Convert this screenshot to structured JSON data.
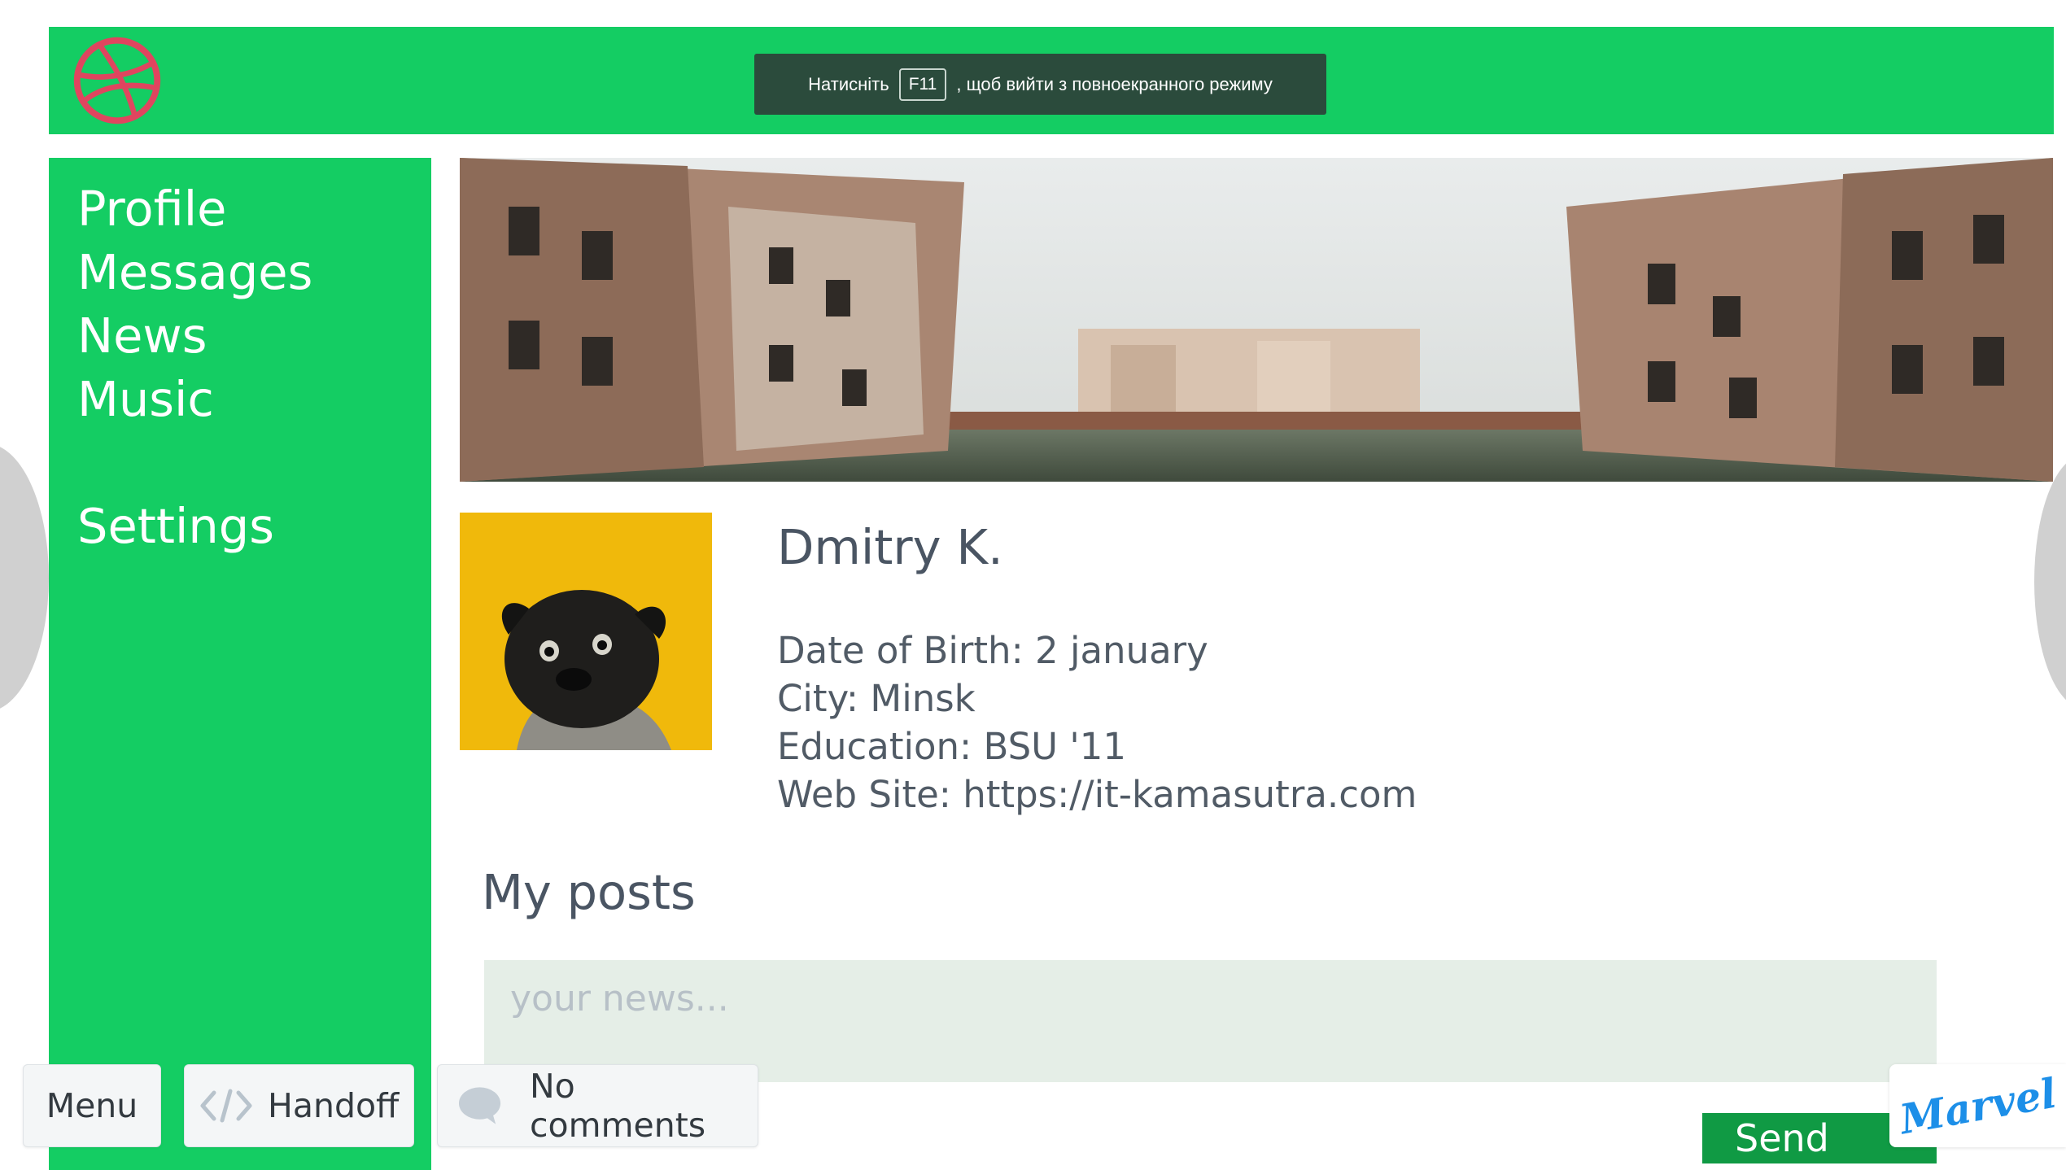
{
  "colors": {
    "brand_green": "#14cd63",
    "send_green": "#109a44",
    "text_dark": "#4a5563",
    "logo_pink": "#e0455f",
    "marvel_blue": "#1d8fe8"
  },
  "header": {
    "logo_icon": "dribbble-ball-icon",
    "fullscreen_notice": {
      "before": "Натисніть",
      "key": "F11",
      "after": ", щоб вийти з повноекранного режиму"
    }
  },
  "sidebar": {
    "items": [
      {
        "label": "Profile"
      },
      {
        "label": "Messages"
      },
      {
        "label": "News"
      },
      {
        "label": "Music"
      },
      {
        "label": "Settings"
      }
    ]
  },
  "profile": {
    "name": "Dmitry K.",
    "date_of_birth": "Date of Birth: 2 january",
    "city": "City: Minsk",
    "education": "Education: BSU '11",
    "website": "Web Site: https://it-kamasutra.com"
  },
  "posts": {
    "title": "My posts",
    "placeholder": "your news...",
    "send_label": "Send"
  },
  "toolbar": {
    "menu_label": "Menu",
    "handoff_label": "Handoff",
    "comments_label": "No comments",
    "brand": "Marvel"
  }
}
